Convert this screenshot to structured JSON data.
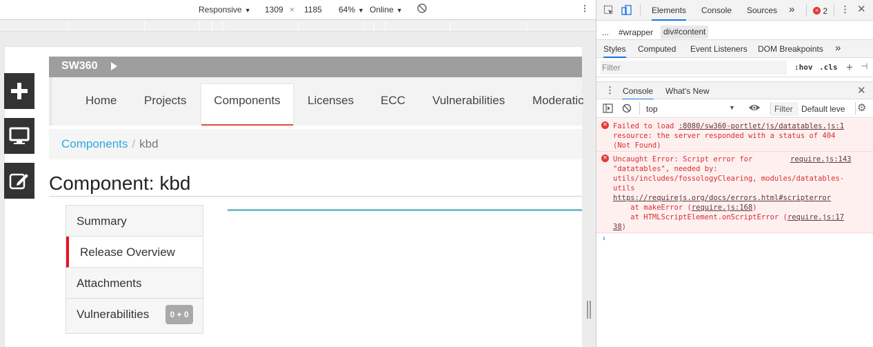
{
  "device_toolbar": {
    "mode": "Responsive",
    "width": "1309",
    "times": "×",
    "height": "1185",
    "zoom": "64%",
    "throttle": "Online"
  },
  "page": {
    "brand": "SW360",
    "nav": [
      "Home",
      "Projects",
      "Components",
      "Licenses",
      "ECC",
      "Vulnerabilities",
      "Moderatic"
    ],
    "breadcrumb": {
      "link": "Components",
      "separator": "/",
      "current": "kbd"
    },
    "title": "Component: kbd",
    "side_tabs": [
      "Summary",
      "Release Overview",
      "Attachments",
      "Vulnerabilities"
    ],
    "vuln_badge": "0 + 0"
  },
  "devtools": {
    "tabs": [
      "Elements",
      "Console",
      "Sources"
    ],
    "more": "»",
    "error_count": "2",
    "crumbs": [
      "...",
      "#wrapper",
      "div#content"
    ],
    "style_tabs": [
      "Styles",
      "Computed",
      "Event Listeners",
      "DOM Breakpoints"
    ],
    "filter_placeholder": "Filter",
    "hov": ":hov",
    "cls": ".cls",
    "drawer_tabs": [
      "Console",
      "What's New"
    ],
    "context": "top",
    "console_filter": "Filter",
    "levels": "Default leve",
    "messages": [
      {
        "lines": [
          "Failed to load ",
          "resource: the server responded with a status of 404",
          "(Not Found)"
        ],
        "link": ":8080/sw360-portlet/js/datatables.js:1"
      },
      {
        "lines": [
          "Uncaught Error: Script error for",
          "\"datatables\", needed by:",
          "utils/includes/fossologyClearing, modules/datatables-",
          "utils"
        ],
        "src": "require.js:143",
        "url": "https://requirejs.org/docs/errors.html#scripterror",
        "stack1_prefix": "    at makeError (",
        "stack1_link": "require.js:168",
        "stack1_suffix": ")",
        "stack2_prefix": "    at HTMLScriptElement.onScriptError (",
        "stack2_link": "require.js:17",
        "stack2_link_cont": "38",
        "stack2_suffix": ")"
      }
    ],
    "prompt": "›"
  },
  "colors": {
    "accent_red": "#e74c3c",
    "breadcrumb_link": "#29a9df",
    "error_text": "#d62f2f",
    "devtools_blue": "#1a73e8"
  }
}
